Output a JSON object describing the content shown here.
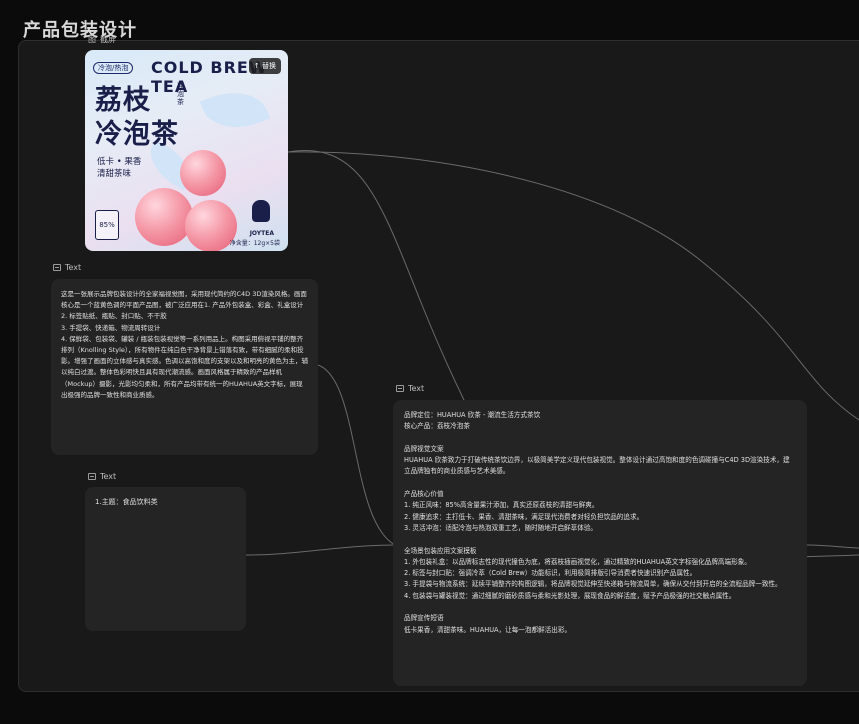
{
  "page": {
    "title": "产品包装设计"
  },
  "image_node": {
    "label": "图",
    "sublabel": "截屏",
    "replace_button": "替换",
    "poster": {
      "tag": "冷泡/热泡",
      "en_title": "COLD BREW TEA",
      "cn_title_line1": "荔枝",
      "cn_title_line2": "冷泡茶",
      "small_vertical": "冲泡茶",
      "sub_line1": "低卡 • 果香",
      "sub_line2": "清甜茶味",
      "teabag_value": "85%",
      "brand": "JOYTEA",
      "net_weight": "净含量：12g×5袋"
    }
  },
  "text_node_1": {
    "label": "Text",
    "content": "这是一张展示品牌包装设计的全家福视觉图，采用现代简约的C4D 3D渲染风格。画面核心是一个蓝黄色调的平面产品图，被广泛应用在1. 产品外包装盒、彩盒、礼盒设计\n2. 标签贴纸、瓶贴、封口贴、不干胶\n3. 手提袋、快递箱、物流周转设计\n4. 保鲜袋、包装袋、罐装 / 瓶装包装视觉等一系列用品上。构图采用俯视平铺的整齐排列（Knolling Style），所有物件在纯白色干净背景上错落有致，带有细腻的柔和投影。增强了画面的立体感与真实感。色调以高饱和度的支架以及和明亮的黄色为主，辅以纯白过渡。整体色彩明快且具有现代潮流感。画面风格属于精致的产品样机（Mockup）摄影，光影均匀柔和，所有产品均带有统一的HUAHUA英文字标，展现出极强的品牌一致性和商业质感。"
  },
  "text_node_2": {
    "label": "Text",
    "content": "1.主题：食品饮料类"
  },
  "text_node_3": {
    "label": "Text",
    "content": "品牌定位：HUAHUA 欣茶 - 潮流生活方式茶饮\n核心产品：荔枝冷泡茶\n\n品牌视觉文案\nHUAHUA 欣茶致力于打破传统茶饮边界，以极简美学定义现代包装视觉。整体设计通过高饱和度的色调碰撞与C4D 3D渲染技术，建立品牌独有的商业质感与艺术美感。\n\n产品核心价值\n1. 纯正风味：85%高含量果汁添加，真实还原荔枝的清甜与鲜爽。\n2. 健康追求：主打低卡、果香、清甜茶味，满足现代消费者对轻负担饮品的追求。\n3. 灵活冲泡：适配冷泡与热泡双重工艺，随时随地开启鲜萃体验。\n\n全场景包装应用文案模板\n1. 外包装礼盒：以品牌标志性的现代撞色为底，将荔枝插画视觉化，通过精致的HUAHUA英文字标强化品牌高端形象。\n2. 标签与封口贴：强调冷萃（Cold Brew）功能标识，利用极简排版引导消费者快速识别产品属性。\n3. 手提袋与物流系统：延续平铺整齐的构图逻辑，将品牌视觉延伸至快递箱与物流周单，确保从交付到开启的全流程品牌一致性。\n4. 包装袋与罐装视觉：通过细腻的磨砂质感与柔和光影处理，展现食品的鲜活度，赋予产品极强的社交触点属性。\n\n品牌宣传短语\n低卡果香，清甜茶味。HUAHUA，让每一泡都鲜活出彩。"
  }
}
